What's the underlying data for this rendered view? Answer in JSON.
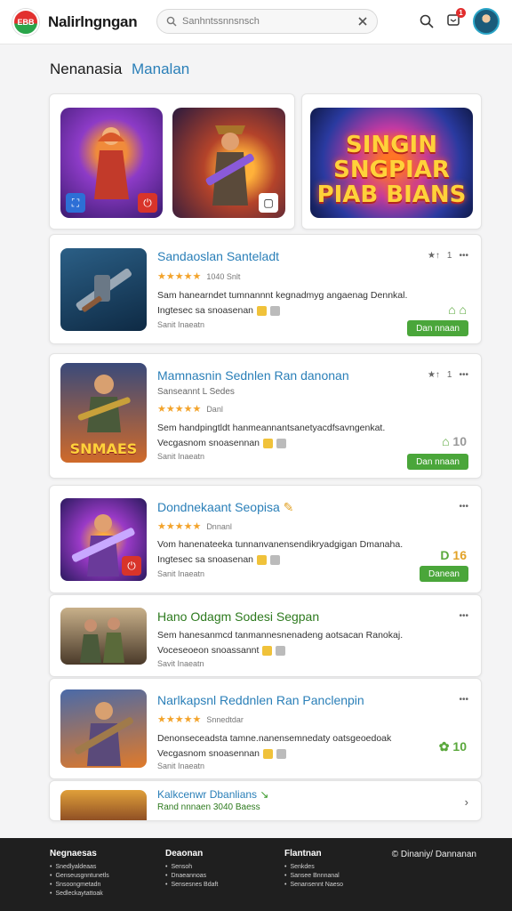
{
  "header": {
    "brand": "Nalirlngngan",
    "logo_text": "EBB",
    "search_placeholder": "Sanhntssnnsnsch",
    "notification_count": "1"
  },
  "page": {
    "title_primary": "Nenanasia",
    "title_secondary": "Manalan"
  },
  "featured": {
    "card3_text": "SINGIN SNGPIAR PIAB BIANS"
  },
  "cards": [
    {
      "title": "Sandaoslan Santeladt",
      "rating": "1040 Snlt",
      "desc1": "Sam hanearndet tumnannnt kegnadmyg angaenag Dennkal.",
      "desc2": "Ingtesec sa snoasenan",
      "meta": "Sanit Inaeatn",
      "menu_a": "1",
      "button": "Dan nnaan"
    },
    {
      "title": "Mamnasnin Sednlen Ran danonan",
      "subtitle": "Sanseannt L Sedes",
      "rating": "Danl",
      "desc1": "Sem handpingtldt hanmeannantsanetyacdfsavngenkat.",
      "desc2": "Vecgasnom snoasennan",
      "meta": "Sanit Inaeatn",
      "menu_a": "1",
      "image_label": "SNMAES",
      "stat_b": "10",
      "button": "Dan nnaan"
    },
    {
      "title": "Dondnekaant Seopisa",
      "rating": "Dnnanl",
      "desc1": "Vom hanenateeka tunnanvanensendikryadgigan Dmanaha.",
      "desc2": "Ingtesec sa snoasenan",
      "meta": "Sanit Inaeatn",
      "stat_a": "D",
      "stat_b": "16",
      "button": "Danean"
    },
    {
      "title": "Hano Odagm Sodesi Segpan",
      "desc1": "Sem hanesanmcd tanmannesnenadeng aotsacan Ranokaj.",
      "desc2": "Voceseoeon snoassannt",
      "meta": "Savit Inaeatn"
    },
    {
      "title": "Narlkapsnl Reddnlen Ran Panclenpin",
      "rating": "Snnedtdar",
      "desc1": "Denonseceadsta tamne.nanensemnedaty oatsgeoedoak",
      "desc2": "Vecgasnom snoasennan",
      "meta": "Sanit Inaeatn",
      "stat": "10"
    },
    {
      "title": "Kalkcenwr Dbanlians",
      "subtitle": "Rand nnnaen 3040 Baess"
    }
  ],
  "footer": {
    "col1": {
      "heading": "Negnaesas",
      "items": [
        "Snedlyaldeaas",
        "Genseusgnntunetls",
        "Snsoongmetadn",
        "Sedleckaytattoak"
      ]
    },
    "col2": {
      "heading": "Deaonan",
      "items": [
        "Sensoh",
        "Dnaeannoas",
        "Sensesnes Bdaft"
      ]
    },
    "col3": {
      "heading": "Flantnan",
      "items": [
        "Senkdes",
        "Sansee Bnnnanal",
        "Senansennt Naeso"
      ]
    },
    "copyright": "© Dinaniy/ Dannanan"
  },
  "colors": {
    "accent_blue": "#2a7fb8",
    "action_green": "#4aa63a",
    "star_orange": "#f3a32a",
    "footer_bg": "#1f1f1f"
  }
}
